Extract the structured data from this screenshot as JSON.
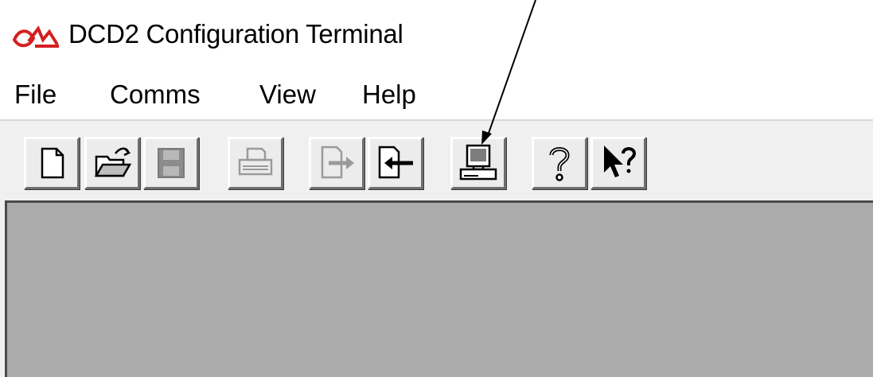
{
  "window": {
    "title": "DCD2 Configuration Terminal",
    "app_icon": "dcd2-app-icon"
  },
  "menu": {
    "items": [
      {
        "label": "File"
      },
      {
        "label": "Comms"
      },
      {
        "label": "View"
      },
      {
        "label": "Help"
      }
    ]
  },
  "toolbar": {
    "buttons": [
      {
        "icon": "new-document-icon",
        "enabled": true
      },
      {
        "icon": "open-folder-icon",
        "enabled": true
      },
      {
        "icon": "save-disk-icon",
        "enabled": false
      },
      {
        "icon": "print-icon",
        "enabled": false
      },
      {
        "icon": "export-arrow-icon",
        "enabled": false
      },
      {
        "icon": "import-arrow-icon",
        "enabled": true
      },
      {
        "icon": "terminal-computer-icon",
        "enabled": true
      },
      {
        "icon": "help-question-icon",
        "enabled": true
      },
      {
        "icon": "context-help-pointer-icon",
        "enabled": true
      }
    ]
  },
  "annotation": {
    "type": "arrow",
    "points_to": "terminal-computer-icon"
  },
  "colors": {
    "client_area": "#ababab",
    "toolbar_bg": "#f0f0f0",
    "app_icon_red": "#d42020"
  }
}
